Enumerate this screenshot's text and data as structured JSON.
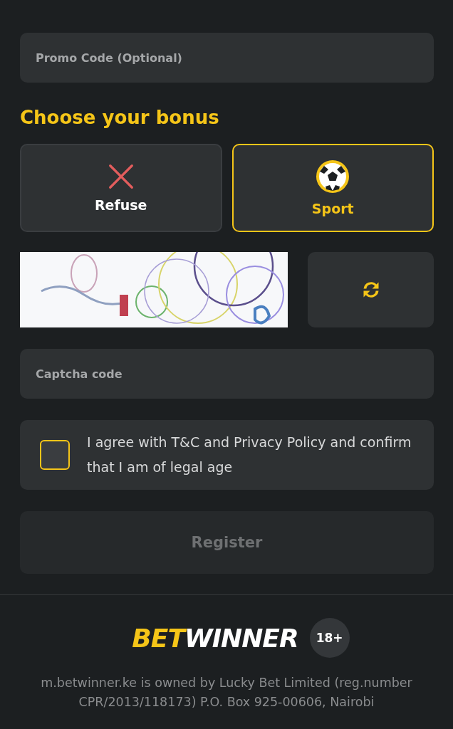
{
  "promo_field": {
    "placeholder": "Promo Code (Optional)"
  },
  "bonus": {
    "heading": "Choose your bonus",
    "options": [
      {
        "kind": "refuse",
        "label": "Refuse",
        "selected": false
      },
      {
        "kind": "sport",
        "label": "Sport",
        "selected": true
      }
    ]
  },
  "captcha": {
    "field": {
      "placeholder": "Captcha code"
    }
  },
  "agreement": {
    "checked": false,
    "text": "I agree with T&C and Privacy Policy and confirm that I am of legal age"
  },
  "register_button": {
    "label": "Register",
    "disabled": true
  },
  "footer": {
    "logo": [
      "BET",
      "WINNER"
    ],
    "age_badge": "18+",
    "legal": "m.betwinner.ke is owned by Lucky Bet Limited (reg.number CPR/2013/118173) P.O. Box 925-00606, Nairobi"
  }
}
